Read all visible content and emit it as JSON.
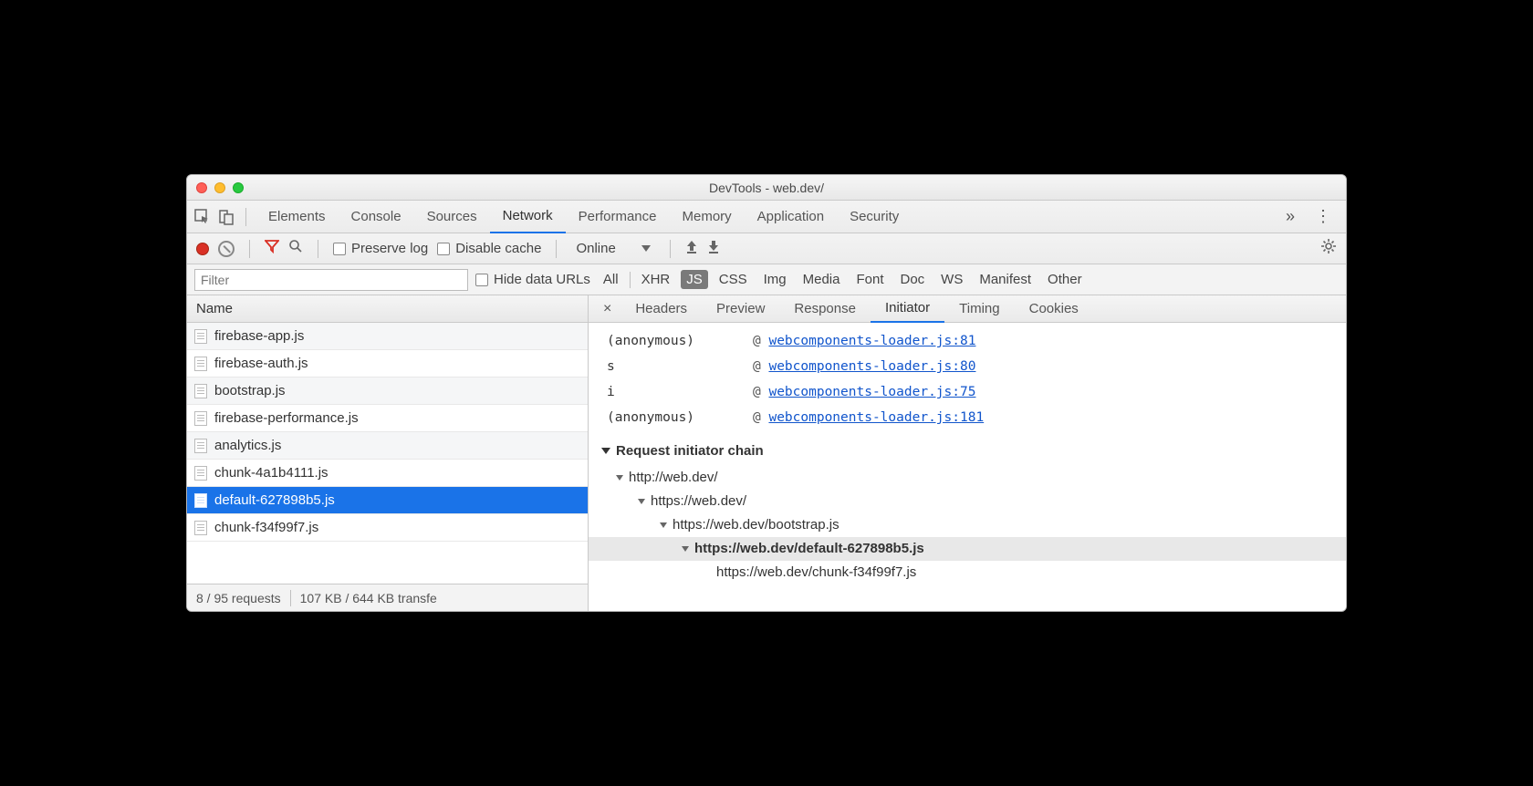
{
  "window": {
    "title": "DevTools - web.dev/"
  },
  "panels": {
    "tabs": [
      "Elements",
      "Console",
      "Sources",
      "Network",
      "Performance",
      "Memory",
      "Application",
      "Security"
    ],
    "active": "Network",
    "overflow": "»",
    "menu": "⋮"
  },
  "toolbar": {
    "preserve_log": "Preserve log",
    "disable_cache": "Disable cache",
    "throttle": "Online"
  },
  "filterbar": {
    "placeholder": "Filter",
    "hide_data_urls": "Hide data URLs",
    "types": [
      "All",
      "XHR",
      "JS",
      "CSS",
      "Img",
      "Media",
      "Font",
      "Doc",
      "WS",
      "Manifest",
      "Other"
    ],
    "active_type": "JS"
  },
  "requests": {
    "column": "Name",
    "rows": [
      "firebase-app.js",
      "firebase-auth.js",
      "bootstrap.js",
      "firebase-performance.js",
      "analytics.js",
      "chunk-4a1b4111.js",
      "default-627898b5.js",
      "chunk-f34f99f7.js"
    ],
    "selected": "default-627898b5.js",
    "status_left": "8 / 95 requests",
    "status_right": "107 KB / 644 KB transfe"
  },
  "detail": {
    "tabs": [
      "Headers",
      "Preview",
      "Response",
      "Initiator",
      "Timing",
      "Cookies"
    ],
    "active": "Initiator",
    "stack": [
      {
        "fn": "(anonymous)",
        "at": "@",
        "link": "webcomponents-loader.js:81"
      },
      {
        "fn": "s",
        "at": "@",
        "link": "webcomponents-loader.js:80"
      },
      {
        "fn": "i",
        "at": "@",
        "link": "webcomponents-loader.js:75"
      },
      {
        "fn": "(anonymous)",
        "at": "@",
        "link": "webcomponents-loader.js:181"
      }
    ],
    "chain_title": "Request initiator chain",
    "chain": [
      {
        "level": 1,
        "text": "http://web.dev/"
      },
      {
        "level": 2,
        "text": "https://web.dev/"
      },
      {
        "level": 3,
        "text": "https://web.dev/bootstrap.js"
      },
      {
        "level": 4,
        "text": "https://web.dev/default-627898b5.js",
        "current": true
      },
      {
        "level": 5,
        "text": "https://web.dev/chunk-f34f99f7.js",
        "leaf": true
      }
    ]
  }
}
